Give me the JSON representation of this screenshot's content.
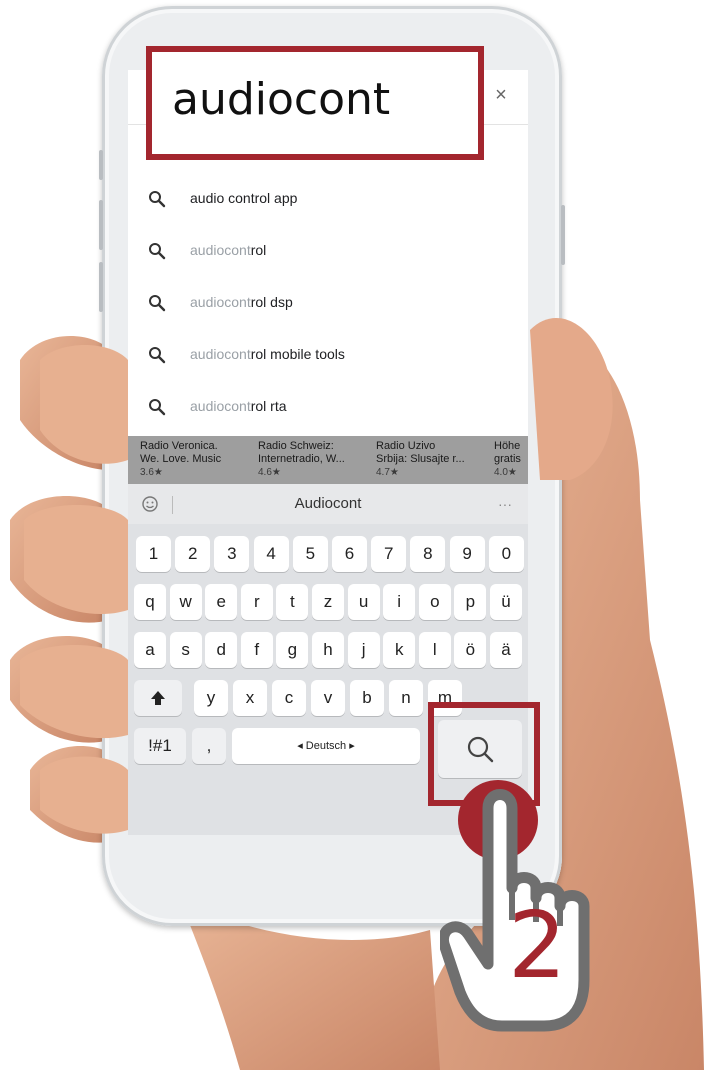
{
  "callout": {
    "search_query": "audiocont",
    "step_number": "2"
  },
  "searchbar": {
    "close_icon": "close-icon"
  },
  "suggestions": [
    {
      "typed": "",
      "rest": "audio control app"
    },
    {
      "typed": "audiocont",
      "rest": "rol"
    },
    {
      "typed": "audiocont",
      "rest": "rol dsp"
    },
    {
      "typed": "audiocont",
      "rest": "rol mobile tools"
    },
    {
      "typed": "audiocont",
      "rest": "rol rta"
    }
  ],
  "apps": [
    {
      "line1": "Radio Veronica.",
      "line2": "We. Love. Music",
      "rating": "3.6★"
    },
    {
      "line1": "Radio Schweiz:",
      "line2": "Internetradio, W...",
      "rating": "4.6★"
    },
    {
      "line1": "Radio Uzivo",
      "line2": "Srbija: Slusajte r...",
      "rating": "4.7★"
    },
    {
      "line1": "Höhe",
      "line2": "gratis",
      "rating": "4.0★"
    }
  ],
  "keyboard": {
    "prediction": "Audiocont",
    "more": "···",
    "row_numbers": [
      "1",
      "2",
      "3",
      "4",
      "5",
      "6",
      "7",
      "8",
      "9",
      "0"
    ],
    "row1": [
      "q",
      "w",
      "e",
      "r",
      "t",
      "z",
      "u",
      "i",
      "o",
      "p",
      "ü"
    ],
    "row2": [
      "a",
      "s",
      "d",
      "f",
      "g",
      "h",
      "j",
      "k",
      "l",
      "ö",
      "ä"
    ],
    "row3": [
      "y",
      "x",
      "c",
      "v",
      "b",
      "n",
      "m"
    ],
    "shift_icon": "shift-arrow-icon",
    "symbols_label": "!#1",
    "comma_label": ",",
    "space_label": "◂ Deutsch ▸",
    "search_icon": "search-icon"
  },
  "colors": {
    "callout_red": "#a3262e",
    "hand_gray": "#6f6f6f"
  }
}
